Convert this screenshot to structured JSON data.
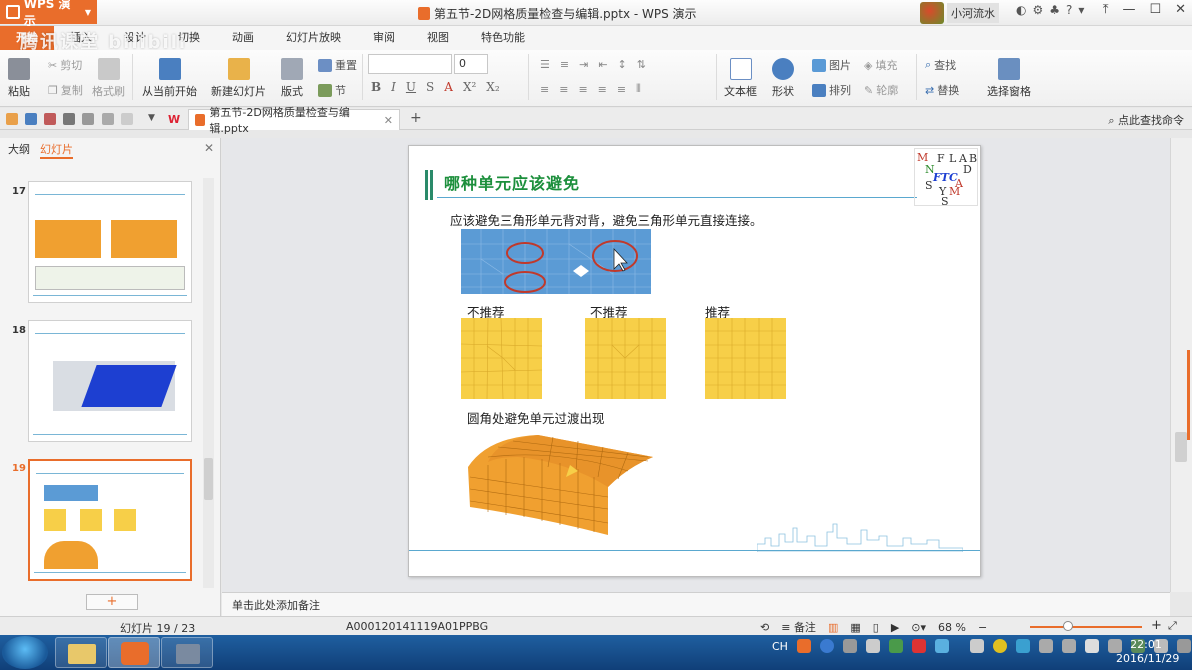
{
  "app": {
    "menu_label": "WPS 演示",
    "doc_title": "第五节-2D网格质量检查与编辑.pptx - WPS 演示",
    "user_name": "小河流水"
  },
  "watermark": "腾讯课堂 bilibili",
  "tabs": [
    "开始",
    "插入",
    "设计",
    "切换",
    "动画",
    "幻灯片放映",
    "审阅",
    "视图",
    "特色功能"
  ],
  "ribbon": {
    "paste": "粘贴",
    "cut": "剪切",
    "copy": "复制",
    "format_painter": "格式刷",
    "from_current": "从当前开始",
    "new_slide": "新建幻灯片",
    "layout": "版式",
    "reset": "重置",
    "section": "节",
    "font_size": "0",
    "text_box": "文本框",
    "shape": "形状",
    "picture": "图片",
    "fill": "填充",
    "arrange": "排列",
    "outline": "轮廓",
    "find": "查找",
    "replace": "替换",
    "select_pane": "选择窗格"
  },
  "doc_tab": "第五节-2D网格质量检查与编辑.pptx",
  "find_command": "点此查找命令",
  "left_panel": {
    "tab_outline": "大纲",
    "tab_slides": "幻灯片",
    "slide_numbers": [
      "17",
      "18",
      "19"
    ]
  },
  "slide": {
    "title": "哪种单元应该避免",
    "subtitle": "应该避免三角形单元背对背，避免三角形单元直接连接。",
    "label_1": "不推荐",
    "label_2": "不推荐",
    "label_3": "推荐",
    "label_fillet": "圆角处避免单元过渡出现",
    "logo_letters": [
      "M",
      "F",
      "L",
      "A",
      "B",
      "N",
      "D",
      "FTC",
      "S",
      "A",
      "Y",
      "M",
      "S"
    ]
  },
  "notes_placeholder": "单击此处添加备注",
  "status": {
    "slide_info": "幻灯片 19 / 23",
    "code": "A000120141119A01PPBG",
    "notes_btn": "备注",
    "zoom": "68 %"
  },
  "taskbar": {
    "lang": "CH",
    "time": "22:01",
    "date": "2016/11/29"
  },
  "colors": {
    "accent": "#e96d2b",
    "title_green": "#1c8f3c",
    "mesh_blue": "#5b9bd5",
    "mesh_yellow": "#f7cf48",
    "mesh_orange": "#f0a030"
  }
}
